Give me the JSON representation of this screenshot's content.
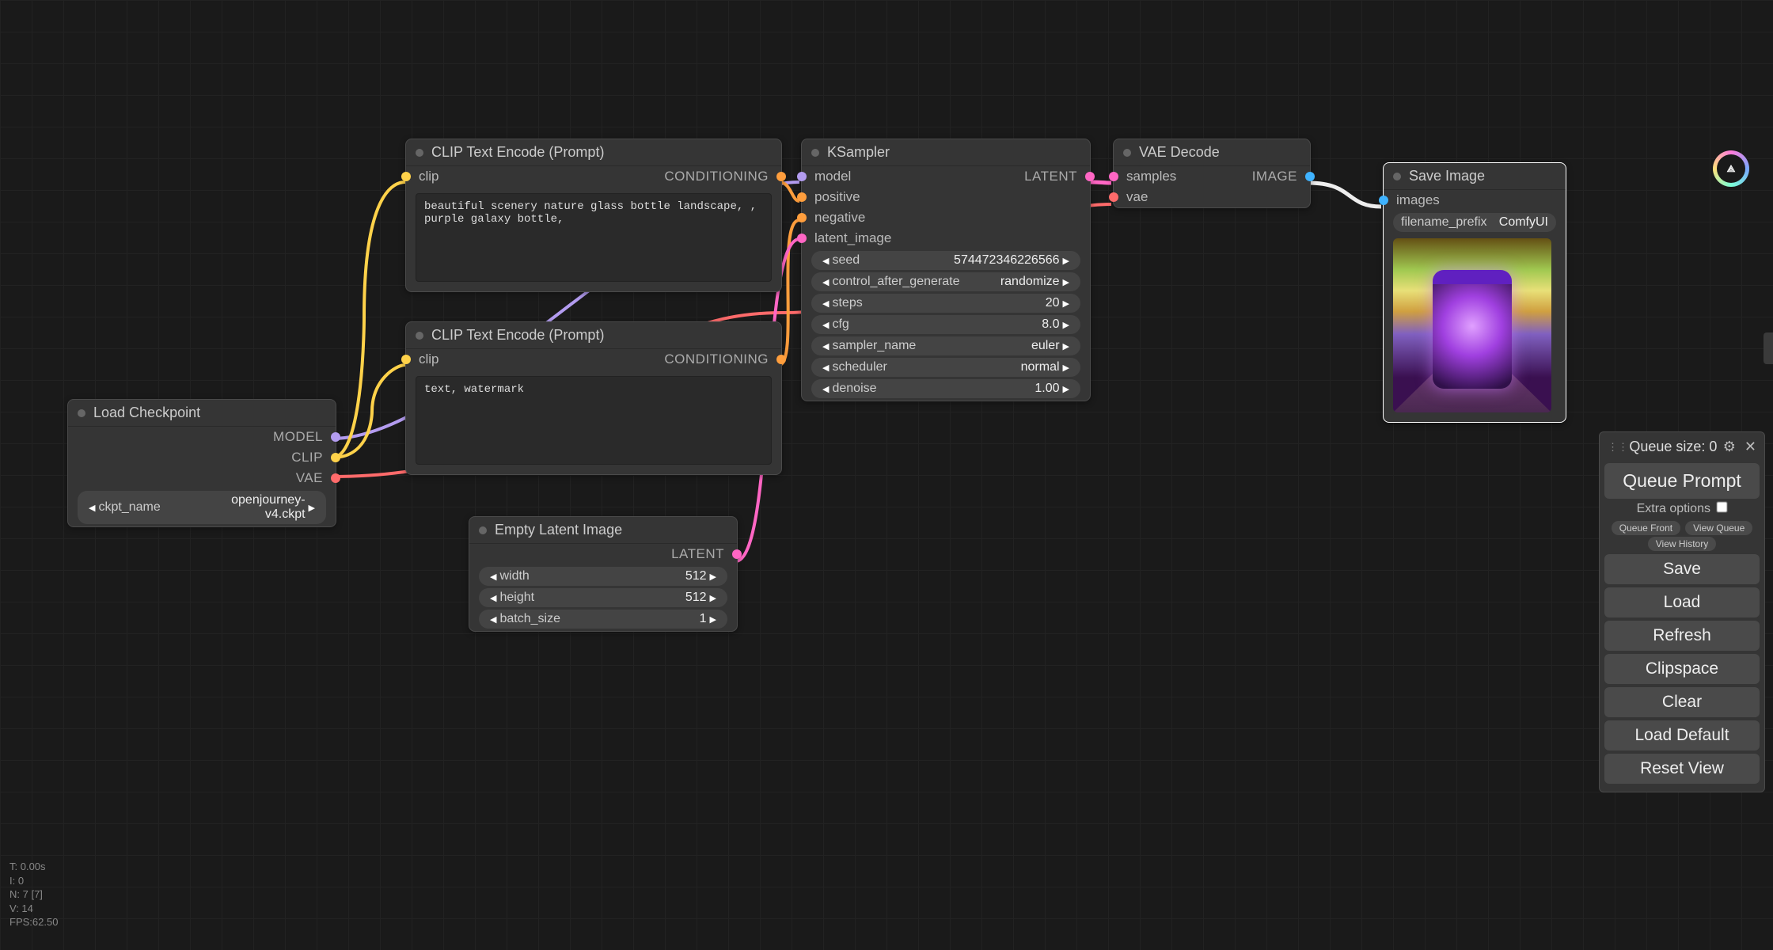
{
  "nodes": {
    "load_ckpt": {
      "title": "Load Checkpoint",
      "outputs": {
        "model": "MODEL",
        "clip": "CLIP",
        "vae": "VAE"
      },
      "widget": {
        "label": "ckpt_name",
        "value": "openjourney-v4.ckpt"
      }
    },
    "clip_pos": {
      "title": "CLIP Text Encode (Prompt)",
      "in_clip": "clip",
      "out_cond": "CONDITIONING",
      "text": "beautiful scenery nature glass bottle landscape, , purple galaxy bottle,"
    },
    "clip_neg": {
      "title": "CLIP Text Encode (Prompt)",
      "in_clip": "clip",
      "out_cond": "CONDITIONING",
      "text": "text, watermark"
    },
    "empty_latent": {
      "title": "Empty Latent Image",
      "out_latent": "LATENT",
      "widgets": [
        {
          "label": "width",
          "value": "512"
        },
        {
          "label": "height",
          "value": "512"
        },
        {
          "label": "batch_size",
          "value": "1"
        }
      ]
    },
    "ksampler": {
      "title": "KSampler",
      "inputs": {
        "model": "model",
        "positive": "positive",
        "negative": "negative",
        "latent_image": "latent_image"
      },
      "out_latent": "LATENT",
      "widgets": [
        {
          "label": "seed",
          "value": "574472346226566"
        },
        {
          "label": "control_after_generate",
          "value": "randomize"
        },
        {
          "label": "steps",
          "value": "20"
        },
        {
          "label": "cfg",
          "value": "8.0"
        },
        {
          "label": "sampler_name",
          "value": "euler"
        },
        {
          "label": "scheduler",
          "value": "normal"
        },
        {
          "label": "denoise",
          "value": "1.00"
        }
      ]
    },
    "vae_decode": {
      "title": "VAE Decode",
      "inputs": {
        "samples": "samples",
        "vae": "vae"
      },
      "out_image": "IMAGE"
    },
    "save_image": {
      "title": "Save Image",
      "in_images": "images",
      "widget": {
        "label": "filename_prefix",
        "value": "ComfyUI"
      }
    }
  },
  "panel": {
    "queue_label": "Queue size: 0",
    "queue_prompt": "Queue Prompt",
    "extra_options": "Extra options",
    "queue_front": "Queue Front",
    "view_queue": "View Queue",
    "view_history": "View History",
    "buttons": [
      "Save",
      "Load",
      "Refresh",
      "Clipspace",
      "Clear",
      "Load Default",
      "Reset View"
    ]
  },
  "stats": {
    "t": "T: 0.00s",
    "i": "I: 0",
    "n": "N: 7 [7]",
    "v": "V: 14",
    "fps": "FPS:62.50"
  }
}
